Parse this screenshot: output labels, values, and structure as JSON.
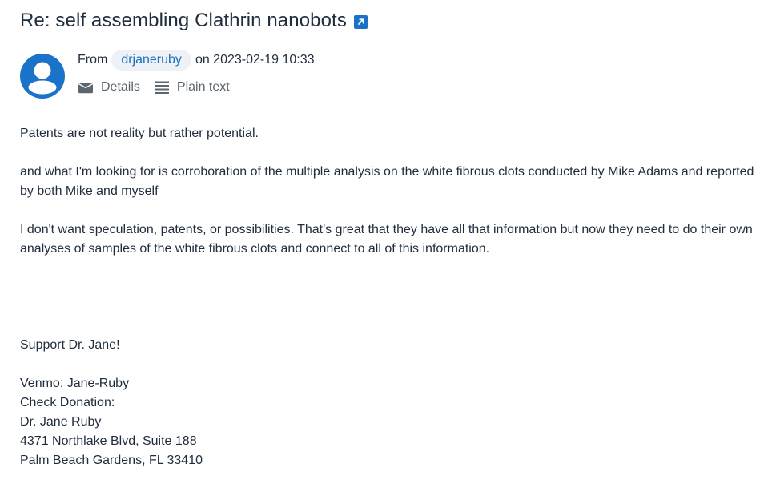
{
  "message": {
    "subject": "Re: self assembling Clathrin nanobots",
    "from_label": "From",
    "sender": "drjaneruby",
    "date_text": "on 2023-02-19 10:33"
  },
  "actions": {
    "details_label": "Details",
    "plain_text_label": "Plain text"
  },
  "icons": {
    "external_link": "external-link-icon",
    "avatar": "user-avatar-icon",
    "details": "envelope-icon",
    "plain_text": "lines-icon"
  },
  "colors": {
    "accent": "#1a73c9",
    "chip_bg": "#eef2f7",
    "text": "#1f2d3d",
    "muted": "#5b6670"
  },
  "body": {
    "p1": "Patents are not reality but rather potential.",
    "p2": "and what I'm looking for is corroboration of the multiple analysis on the white fibrous clots conducted by Mike Adams and reported by both Mike and myself",
    "p3": "I don't want speculation, patents, or possibilities. That's great that they have all that information but now they need to do their own analyses of samples of the white fibrous clots and connect to all of this information.",
    "signature": {
      "support": "Support Dr. Jane!",
      "venmo": "Venmo: Jane-Ruby",
      "check": "Check Donation:",
      "name": "Dr. Jane Ruby",
      "address1": "4371 Northlake Blvd, Suite 188",
      "address2": "Palm Beach Gardens, FL 33410"
    }
  }
}
